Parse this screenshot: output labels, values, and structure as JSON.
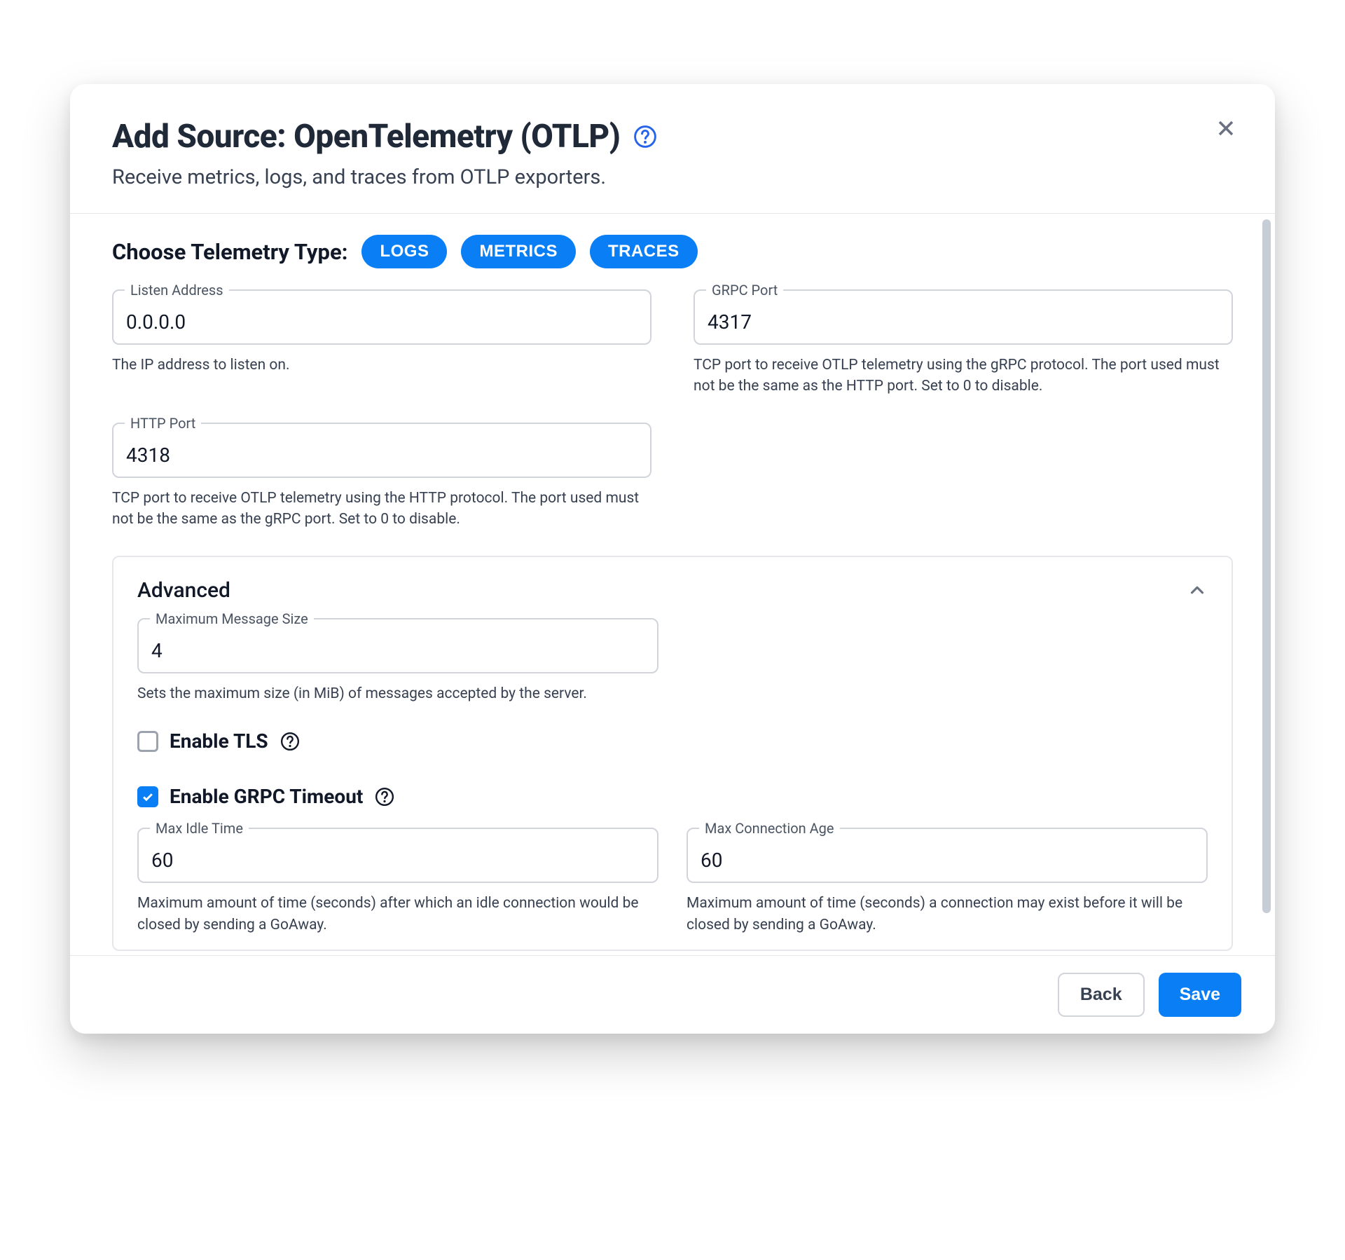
{
  "header": {
    "title": "Add Source: OpenTelemetry (OTLP)",
    "subtitle": "Receive metrics, logs, and traces from OTLP exporters."
  },
  "telemetry": {
    "label": "Choose Telemetry Type:",
    "chips": [
      "LOGS",
      "METRICS",
      "TRACES"
    ]
  },
  "fields": {
    "listen_address": {
      "label": "Listen Address",
      "value": "0.0.0.0",
      "help": "The IP address to listen on."
    },
    "grpc_port": {
      "label": "GRPC Port",
      "value": "4317",
      "help": "TCP port to receive OTLP telemetry using the gRPC protocol. The port used must not be the same as the HTTP port. Set to 0 to disable."
    },
    "http_port": {
      "label": "HTTP Port",
      "value": "4318",
      "help": "TCP port to receive OTLP telemetry using the HTTP protocol. The port used must not be the same as the gRPC port. Set to 0 to disable."
    }
  },
  "advanced": {
    "title": "Advanced",
    "max_msg": {
      "label": "Maximum Message Size",
      "value": "4",
      "help": "Sets the maximum size (in MiB) of messages accepted by the server."
    },
    "enable_tls": {
      "label": "Enable TLS",
      "checked": false
    },
    "enable_grpc_timeout": {
      "label": "Enable GRPC Timeout",
      "checked": true
    },
    "max_idle": {
      "label": "Max Idle Time",
      "value": "60",
      "help": "Maximum amount of time (seconds) after which an idle connection would be closed by sending a GoAway."
    },
    "max_conn_age": {
      "label": "Max Connection Age",
      "value": "60",
      "help": "Maximum amount of time (seconds) a connection may exist before it will be closed by sending a GoAway."
    }
  },
  "footer": {
    "back": "Back",
    "save": "Save"
  }
}
